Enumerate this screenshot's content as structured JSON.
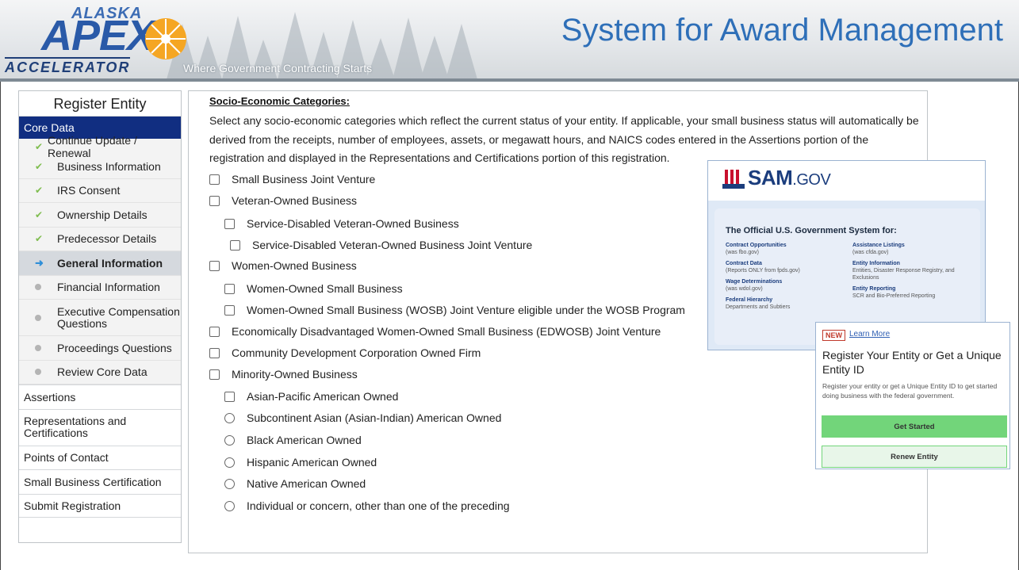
{
  "banner": {
    "logo_top": "ALASKA",
    "logo_main": "APEX",
    "logo_bottom": "ACCELERATOR",
    "tagline": "Where Government Contracting Starts",
    "title": "System for Award Management"
  },
  "sidebar": {
    "title": "Register Entity",
    "core": "Core Data",
    "sub_items": [
      {
        "label": "Continue Update / Renewal",
        "status": "check"
      },
      {
        "label": "Business Information",
        "status": "check"
      },
      {
        "label": "IRS Consent",
        "status": "check"
      },
      {
        "label": "Ownership Details",
        "status": "check"
      },
      {
        "label": "Predecessor Details",
        "status": "check"
      },
      {
        "label": "General Information",
        "status": "current"
      },
      {
        "label": "Financial Information",
        "status": "pending"
      },
      {
        "label": "Executive Compensation Questions",
        "status": "pending"
      },
      {
        "label": "Proceedings Questions",
        "status": "pending"
      },
      {
        "label": "Review Core Data",
        "status": "pending"
      }
    ],
    "sections": [
      "Assertions",
      "Representations and Certifications",
      "Points of Contact",
      "Small Business Certification",
      "Submit Registration"
    ]
  },
  "main": {
    "heading": "Socio-Economic Categories:",
    "description": "Select any socio-economic categories which reflect the current status of your entity. If applicable, your small business status will automatically be derived from the receipts, number of employees, assets, or megawatt hours, and NAICS codes entered in the Assertions portion of the registration and displayed in the Representations and Certifications portion of this registration.",
    "options": [
      {
        "label": "Small Business Joint Venture",
        "type": "checkbox"
      },
      {
        "label": "Veteran-Owned Business",
        "type": "checkbox"
      },
      {
        "label": "Service-Disabled Veteran-Owned Business",
        "type": "checkbox"
      },
      {
        "label": "Service-Disabled Veteran-Owned Business Joint Venture",
        "type": "checkbox"
      },
      {
        "label": "Women-Owned Business",
        "type": "checkbox"
      },
      {
        "label": "Women-Owned Small Business",
        "type": "checkbox"
      },
      {
        "label": "Women-Owned Small Business (WOSB) Joint Venture eligible under the WOSB Program",
        "type": "checkbox"
      },
      {
        "label": "Economically Disadvantaged Women-Owned Small Business (EDWOSB) Joint Venture",
        "type": "checkbox"
      },
      {
        "label": "Community Development Corporation Owned Firm",
        "type": "checkbox"
      },
      {
        "label": "Minority-Owned Business",
        "type": "checkbox"
      },
      {
        "label": "Asian-Pacific American Owned",
        "type": "checkbox"
      },
      {
        "label": "Subcontinent Asian (Asian-Indian) American Owned",
        "type": "radio"
      },
      {
        "label": "Black American Owned",
        "type": "radio"
      },
      {
        "label": "Hispanic American Owned",
        "type": "radio"
      },
      {
        "label": "Native American Owned",
        "type": "radio"
      },
      {
        "label": "Individual or concern, other than one of the preceding",
        "type": "radio"
      }
    ]
  },
  "sam": {
    "logo": "SAM",
    "logo_suffix": ".GOV",
    "tagline": "The Official U.S. Government System for:",
    "left_col": [
      {
        "title": "Contract Opportunities",
        "sub": "(was fbo.gov)"
      },
      {
        "title": "Contract Data",
        "sub": "(Reports ONLY from fpds.gov)"
      },
      {
        "title": "Wage Determinations",
        "sub": "(was wdol.gov)"
      },
      {
        "title": "Federal Hierarchy",
        "sub": "Departments and Subtiers"
      }
    ],
    "right_col": [
      {
        "title": "Assistance Listings",
        "sub": "(was cfda.gov)"
      },
      {
        "title": "Entity Information",
        "sub": "Entities, Disaster Response Registry, and Exclusions"
      },
      {
        "title": "Entity Reporting",
        "sub": "SCR and Bio-Preferred Reporting"
      }
    ]
  },
  "register": {
    "badge": "NEW",
    "learn_more": "Learn More",
    "title": "Register Your Entity or Get a Unique Entity ID",
    "description": "Register your entity or get a Unique Entity ID to get started doing business with the federal government.",
    "start_button": "Get Started",
    "renew_button": "Renew Entity"
  },
  "colors": {
    "nav_active": "#112e81",
    "title_blue": "#2e6fb8",
    "check_green": "#7fbd4f",
    "button_green": "#72d57a"
  }
}
